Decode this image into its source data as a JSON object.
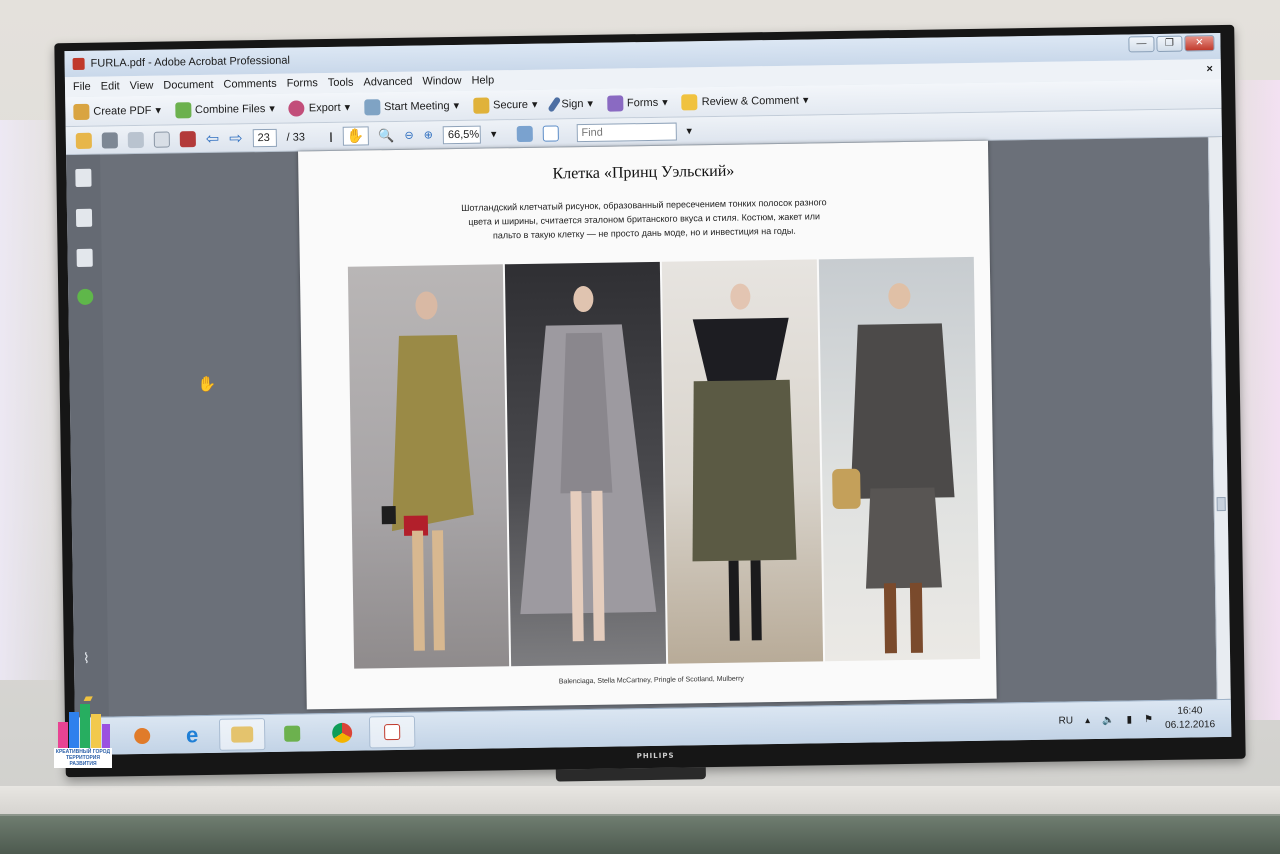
{
  "window": {
    "title": "FURLA.pdf - Adobe Acrobat Professional",
    "minimize": "—",
    "maximize": "❐",
    "close": "✕",
    "doc_close": "×"
  },
  "menu": [
    "File",
    "Edit",
    "View",
    "Document",
    "Comments",
    "Forms",
    "Tools",
    "Advanced",
    "Window",
    "Help"
  ],
  "toolbar": {
    "create_pdf": "Create PDF",
    "combine_files": "Combine Files",
    "export": "Export",
    "start_meeting": "Start Meeting",
    "secure": "Secure",
    "sign": "Sign",
    "forms": "Forms",
    "review_comment": "Review & Comment"
  },
  "nav": {
    "page_current": "23",
    "page_total": "/ 33",
    "zoom": "66,5%",
    "find_placeholder": "Find"
  },
  "page": {
    "title": "Клетка «Принц Уэльский»",
    "body": "Шотландский клетчатый рисунок, образованный пересечением тонких полосок разного цвета и ширины, считается эталоном британского вкуса и стиля. Костюм, жакет или пальто в такую клетку — не просто дань моде, но и инвестиция на годы.",
    "caption": "Balenciaga, Stella McCartney, Pringle of Scotland, Mulberry"
  },
  "taskbar": {
    "lang": "RU",
    "time": "16:40",
    "date": "06.12.2016"
  },
  "tv_brand": "PHILIPS",
  "logo": {
    "line1": "КРЕАТИВНЫЙ ГОРОД",
    "line2": "ТЕРРИТОРИЯ РАЗВИТИЯ"
  }
}
